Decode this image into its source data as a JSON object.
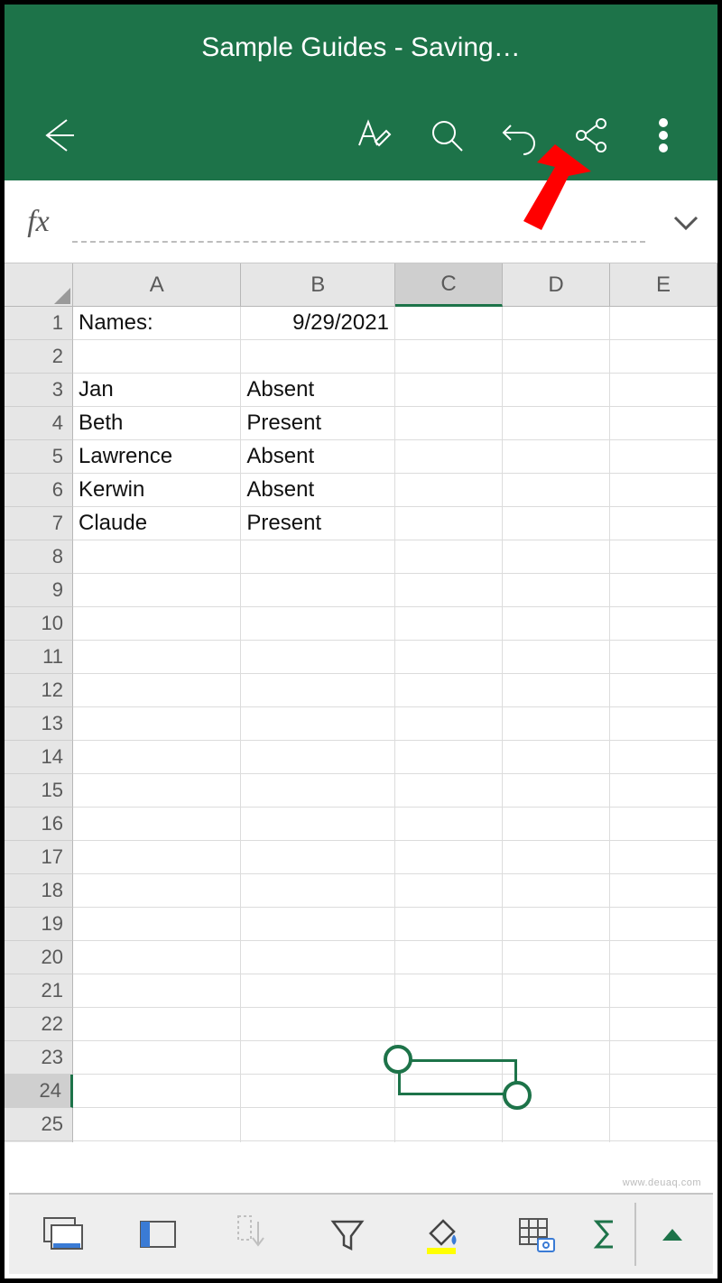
{
  "header": {
    "title": "Sample Guides - Saving…"
  },
  "formula_bar": {
    "fx_label": "fx",
    "value": ""
  },
  "columns": [
    "A",
    "B",
    "C",
    "D",
    "E"
  ],
  "selected_column": "C",
  "row_count": 26,
  "selected_row": 24,
  "cells": {
    "A1": "Names:",
    "B1": "9/29/2021",
    "A3": "Jan",
    "B3": "Absent",
    "A4": "Beth",
    "B4": "Present",
    "A5": "Lawrence",
    "B5": "Absent",
    "A6": "Kerwin",
    "B6": "Absent",
    "A7": "Claude",
    "B7": "Present"
  },
  "right_aligned": [
    "B1"
  ],
  "colors": {
    "header_bg": "#1d7349",
    "selection": "#1d7349"
  }
}
